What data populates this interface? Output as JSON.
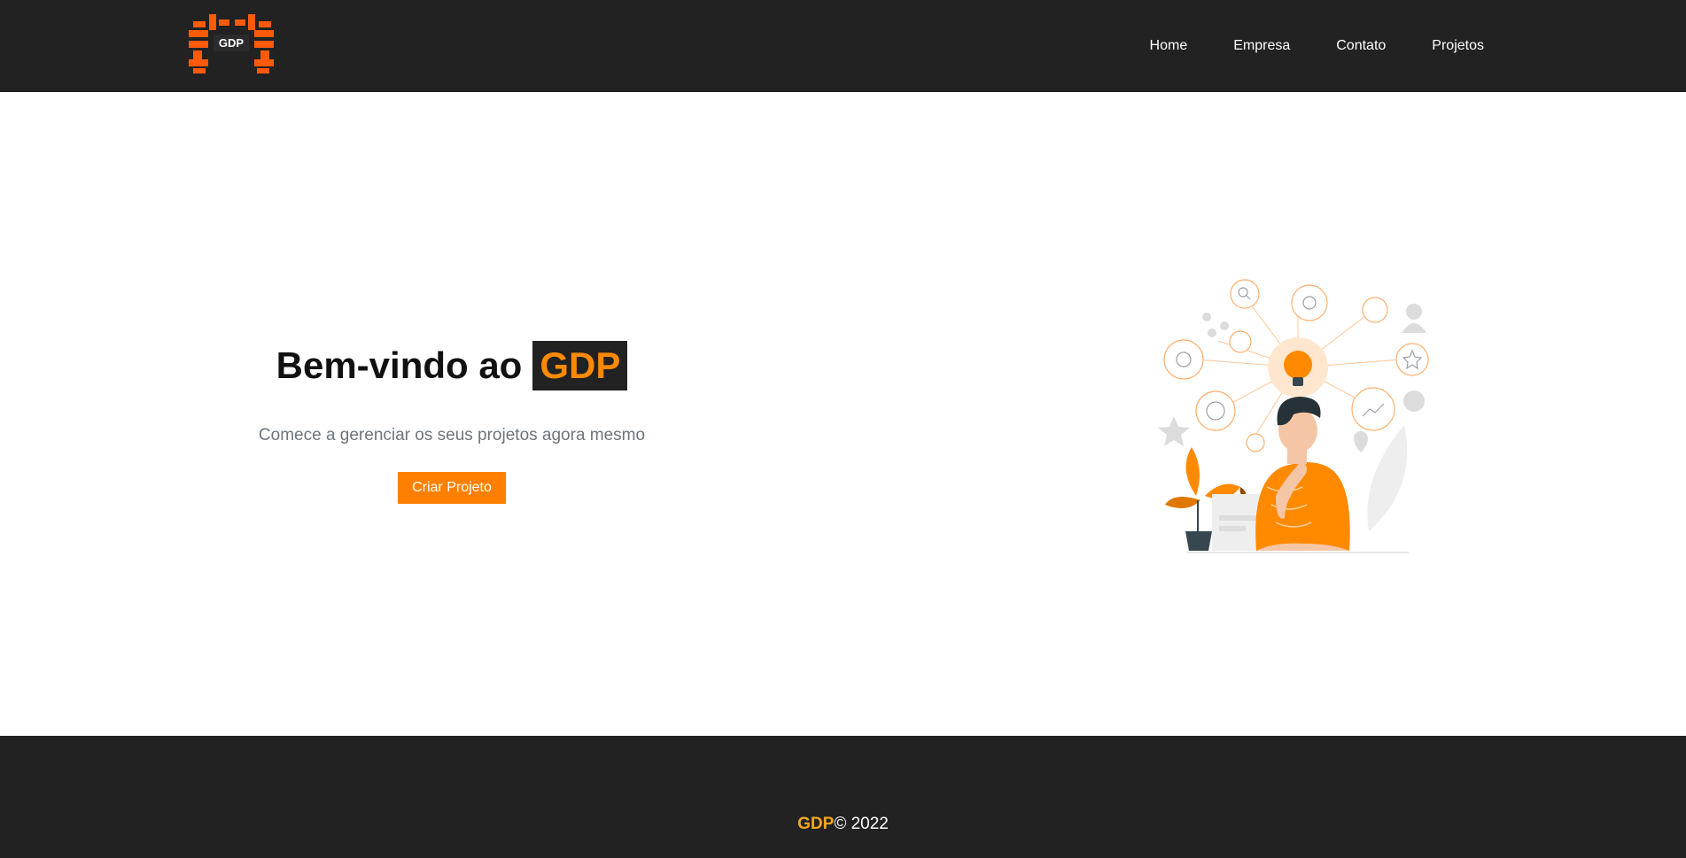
{
  "header": {
    "logo_text": "GDP",
    "nav": [
      {
        "label": "Home"
      },
      {
        "label": "Empresa"
      },
      {
        "label": "Contato"
      },
      {
        "label": "Projetos"
      }
    ]
  },
  "hero": {
    "title_prefix": "Bem-vindo ao",
    "title_brand": "GDP",
    "subtitle": "Comece a gerenciar os seus projetos agora mesmo",
    "cta_label": "Criar Projeto",
    "illustration": "thinking-person-lightbulb-illustration"
  },
  "footer": {
    "brand": "GDP",
    "copyright": "© 2022"
  },
  "colors": {
    "nav_bg": "#222222",
    "accent": "#ff8000",
    "brand_orange": "#ff8a00",
    "footer_brand": "#f5a623"
  }
}
